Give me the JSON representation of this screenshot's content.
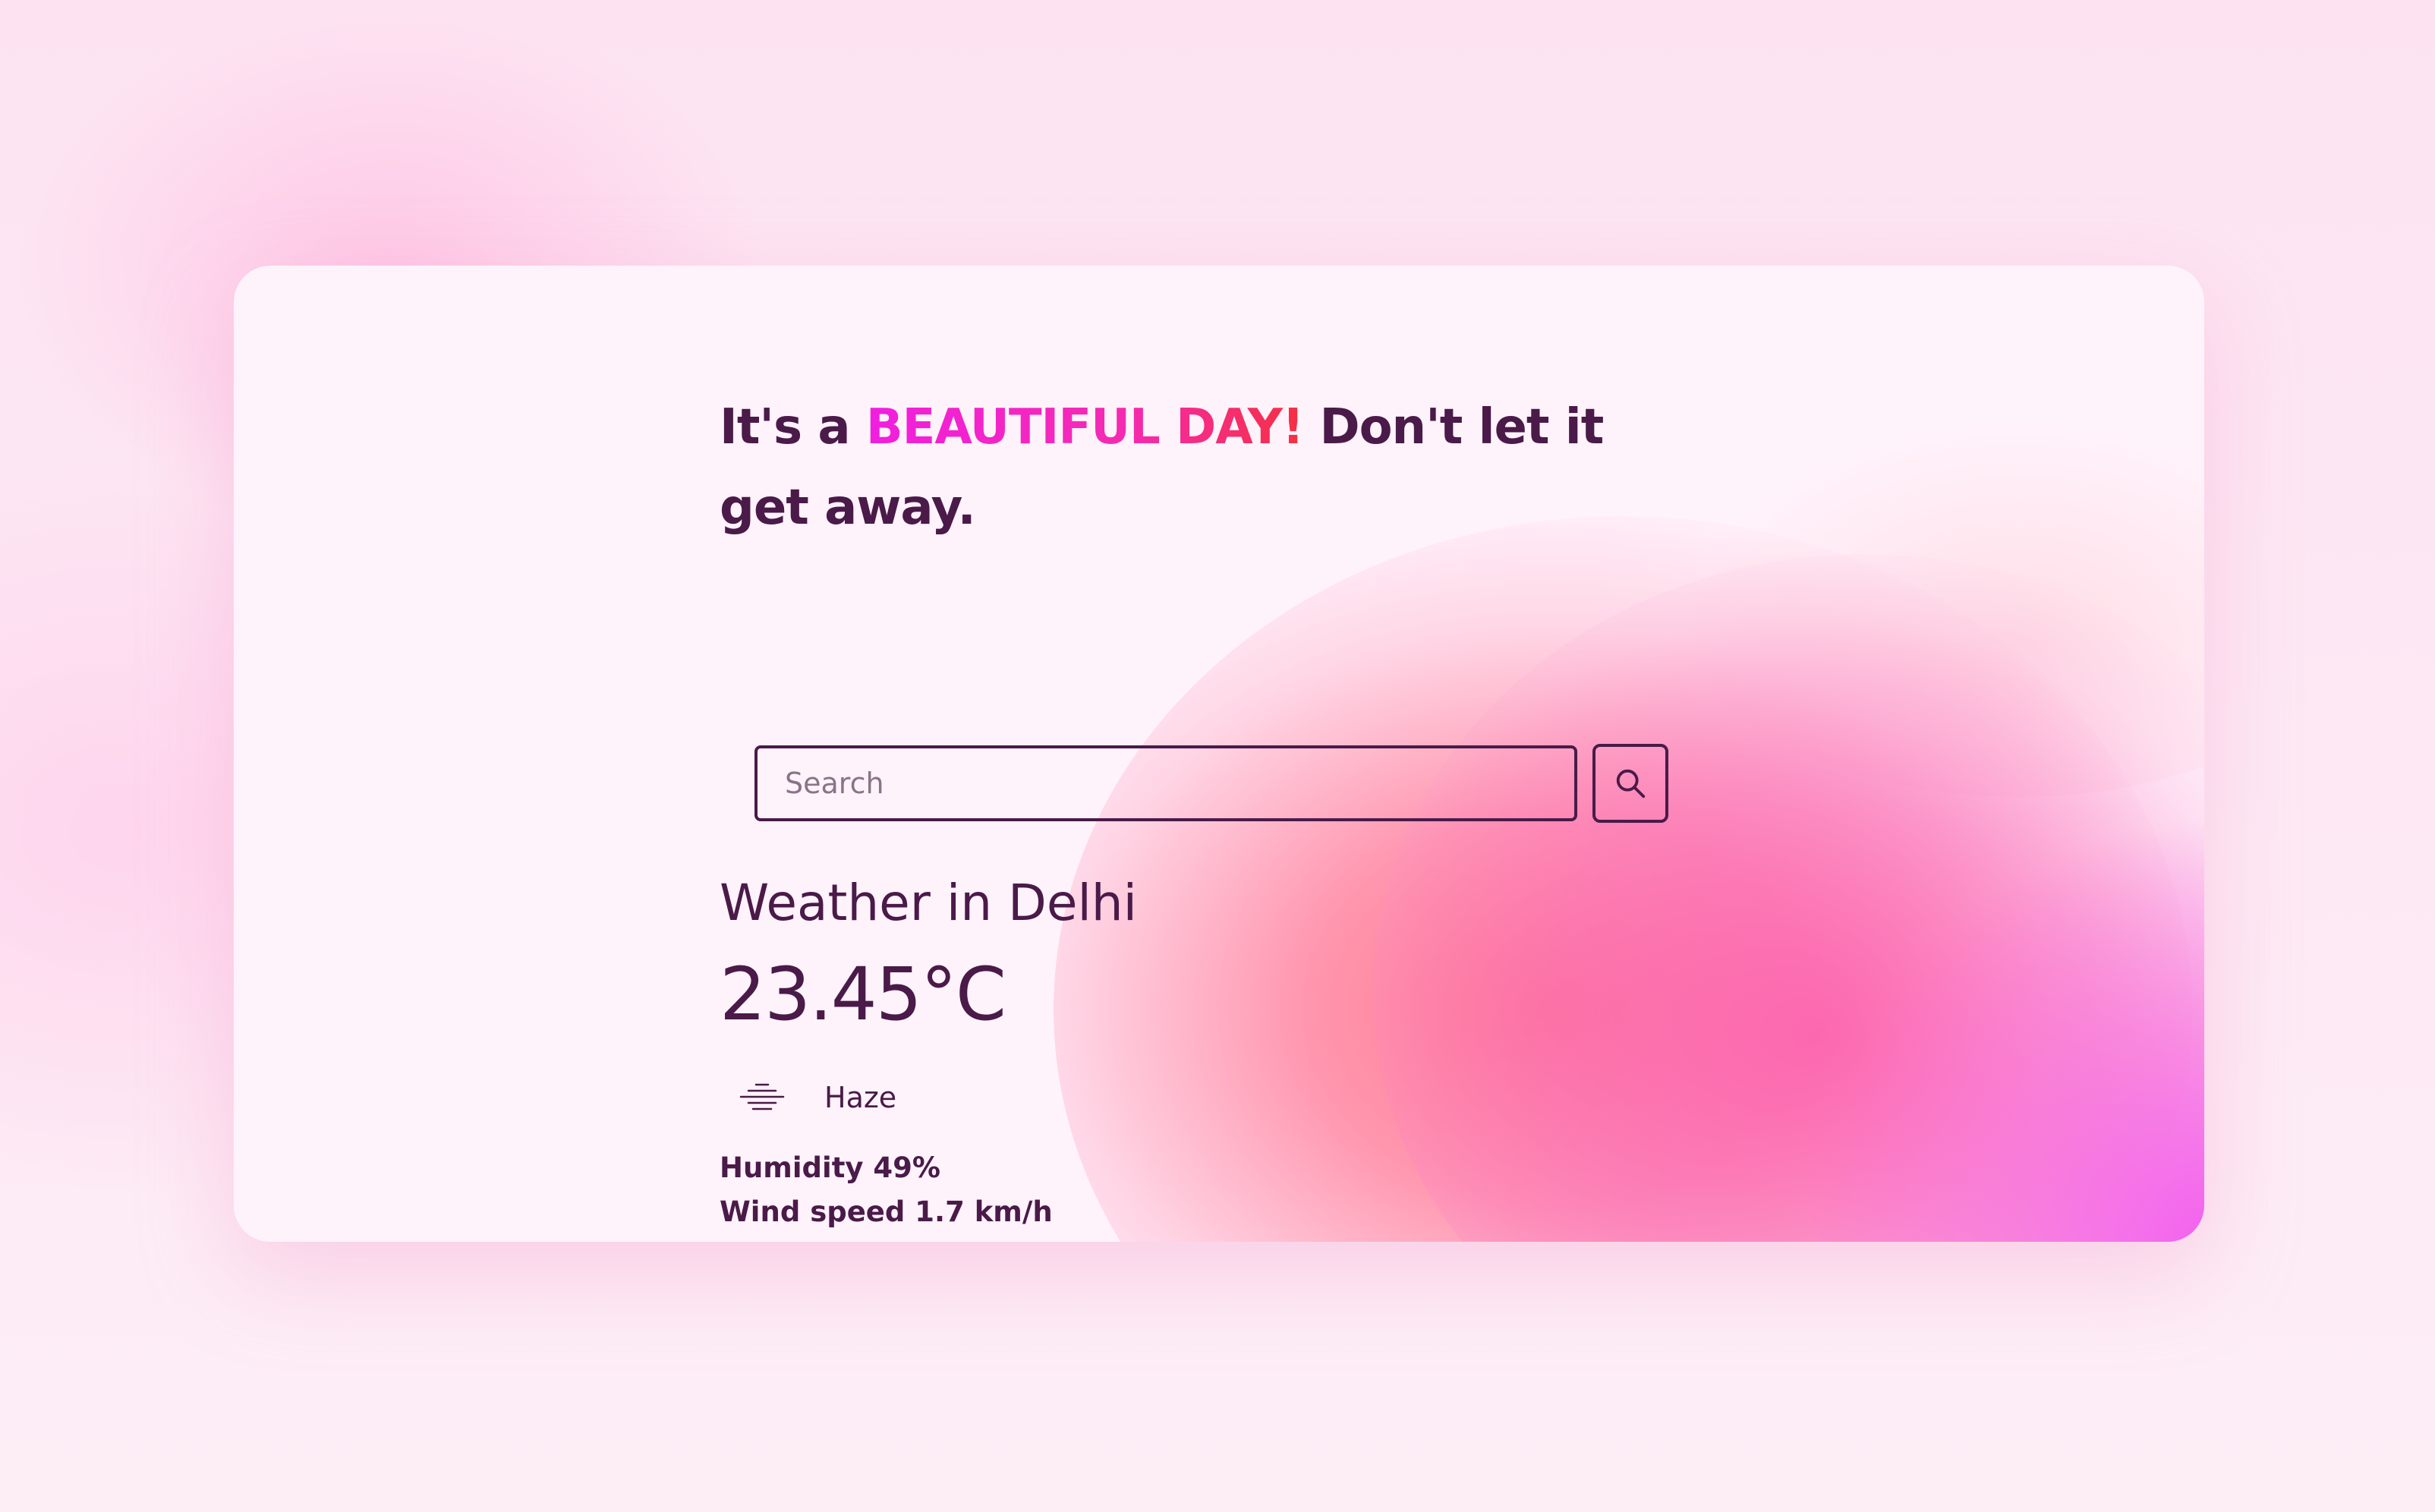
{
  "headline": {
    "part1": "It's a ",
    "highlight": "BEAUTIFUL DAY!",
    "part2": " Don't let it get away."
  },
  "search": {
    "placeholder": "Search",
    "value": "",
    "button_icon": "search-icon"
  },
  "weather": {
    "city_title": "Weather in Delhi",
    "temperature": "23.45°C",
    "condition_icon": "haze-icon",
    "condition": "Haze",
    "humidity": "Humidity 49%",
    "wind_speed": "Wind speed 1.7 km/h"
  },
  "colors": {
    "text": "#4a1a49",
    "highlight_start": "#f01fe0",
    "highlight_end": "#f53040",
    "page_background": "#fde8f4",
    "card_background": "#fff3fb",
    "blob_salmon": "#ff6e82",
    "blob_pink": "#fc5faf",
    "blob_magenta": "#f050f0"
  }
}
